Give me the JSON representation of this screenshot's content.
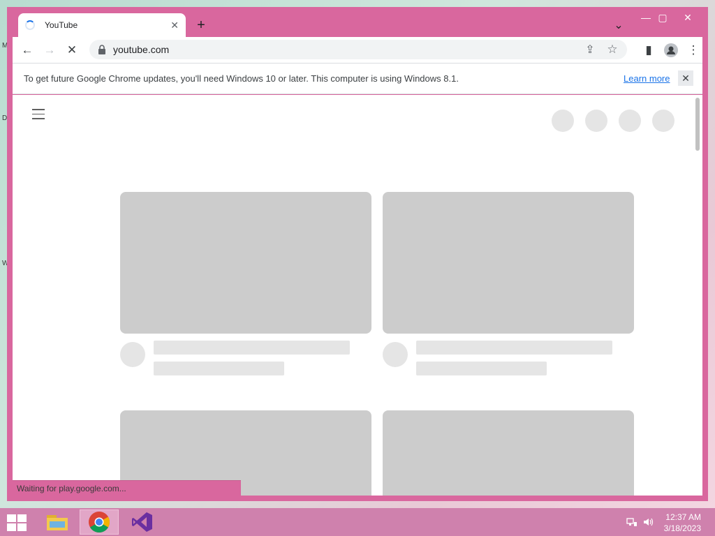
{
  "desktop": {
    "edge_labels": [
      "M",
      "D",
      "W"
    ]
  },
  "window": {
    "controls": {
      "minimize": "—",
      "maximize": "▢",
      "close": "✕"
    }
  },
  "tab": {
    "title": "YouTube",
    "close": "✕",
    "new_tab": "+",
    "search_tabs": "⌄"
  },
  "toolbar": {
    "back": "←",
    "forward": "→",
    "stop": "✕",
    "url": "youtube.com",
    "share": "⇪",
    "bookmark": "☆",
    "side_panel": "▮",
    "menu": "⋮"
  },
  "infobar": {
    "message": "To get future Google Chrome updates, you'll need Windows 10 or later. This computer is using Windows 8.1.",
    "link": "Learn more",
    "close": "✕"
  },
  "status": {
    "text": "Waiting for play.google.com..."
  },
  "taskbar": {
    "time": "12:37 AM",
    "date": "3/18/2023"
  },
  "colors": {
    "window_frame": "#d9679e",
    "taskbar": "#cf81ad",
    "placeholder_thumb": "#cccccc",
    "placeholder_light": "#e5e5e5",
    "link": "#1a73e8"
  }
}
